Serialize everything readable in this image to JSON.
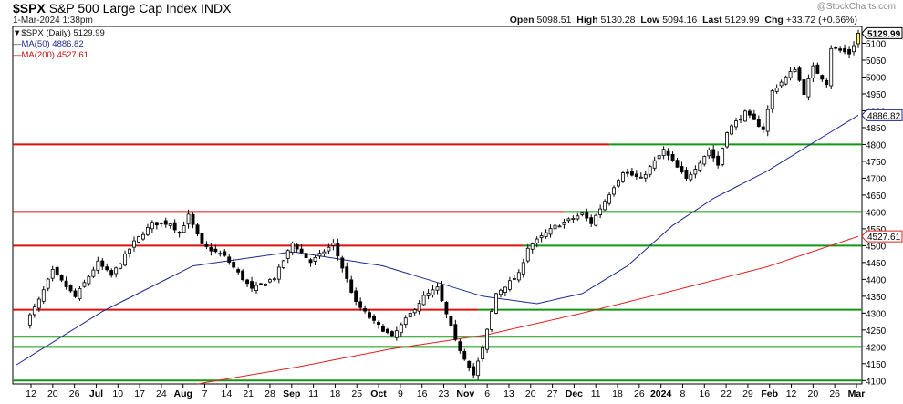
{
  "header": {
    "symbol": "$SPX",
    "name": "S&P 500 Large Cap Index",
    "exchange": "INDX",
    "datetime": "1-Mar-2024 1:38pm",
    "credit": "@StockCharts.com",
    "ohlc": {
      "open_label": "Open",
      "open": "5098.51",
      "high_label": "High",
      "high": "5130.28",
      "low_label": "Low",
      "low": "5094.16",
      "last_label": "Last",
      "last": "5129.99",
      "chg_label": "Chg",
      "chg": "+33.72 (+0.66%)"
    }
  },
  "legend": {
    "price": "$SPX (Daily) 5129.99",
    "ma50": "MA(50) 4886.82",
    "ma200": "MA(200) 4527.61"
  },
  "colors": {
    "red_line": "#dd1111",
    "green_line": "#139713",
    "ma50": "#1f2a8c",
    "ma200": "#e02020",
    "up_candle": "#ffffff",
    "down_candle": "#000000",
    "last_candle": "#ffff66"
  },
  "chart_data": {
    "type": "candlestick",
    "title": "$SPX S&P 500 Large Cap Index INDX",
    "y_axis": {
      "position": "right",
      "range": [
        4090,
        5150
      ],
      "ticks": [
        4100,
        4150,
        4200,
        4250,
        4300,
        4350,
        4400,
        4450,
        4500,
        4550,
        4600,
        4650,
        4700,
        4750,
        4800,
        4850,
        4900,
        4950,
        5000,
        5050,
        5100
      ],
      "tick_labels": [
        "4100",
        "4150",
        "4200",
        "4250",
        "4300",
        "4350",
        "4400",
        "4450",
        "4500",
        "4550",
        "4600",
        "4650",
        "4700",
        "4750",
        "4800",
        "4850",
        "4900",
        "4950",
        "5000",
        "5050",
        "5100"
      ]
    },
    "x_axis": {
      "labels": [
        "12",
        "20",
        "26",
        "Jul",
        "10",
        "17",
        "24",
        "Aug",
        "7",
        "14",
        "21",
        "28",
        "Sep",
        "11",
        "18",
        "25",
        "Oct",
        "9",
        "16",
        "23",
        "Nov",
        "6",
        "13",
        "20",
        "27",
        "Dec",
        "11",
        "18",
        "26",
        "2024",
        "8",
        "16",
        "22",
        "29",
        "Feb",
        "12",
        "20",
        "26",
        "Mar"
      ],
      "bold": [
        "Jul",
        "Aug",
        "Sep",
        "Oct",
        "Nov",
        "Dec",
        "2024",
        "Feb",
        "Mar"
      ]
    },
    "value_tags": [
      {
        "label": "5129.99",
        "value": 5129.99,
        "style": "last"
      },
      {
        "label": "4886.82",
        "value": 4886.82,
        "style": "ma50"
      },
      {
        "label": "4527.61",
        "value": 4527.61,
        "style": "ma200"
      }
    ],
    "horizontal_lines": [
      {
        "value": 4800,
        "left": "red",
        "right": "green",
        "split_date": "2023-12-11"
      },
      {
        "value": 4600,
        "left": "red",
        "right": "green",
        "split_date": "2023-11-27"
      },
      {
        "value": 4500,
        "left": "red",
        "right": "green",
        "split_date": "2023-11-13"
      },
      {
        "value": 4310,
        "left": "red",
        "right": "green",
        "split_date": "2023-10-30"
      },
      {
        "value": 4230,
        "left": "green",
        "right": "green",
        "split_date": "2023-10-30"
      },
      {
        "value": 4200,
        "left": "green",
        "right": "green",
        "split_date": "2023-10-30"
      },
      {
        "value": 4100,
        "left": "green",
        "right": "green",
        "split_date": "2023-10-30"
      }
    ],
    "series": [
      {
        "name": "$SPX (Daily)",
        "type": "candlestick",
        "anchors": [
          {
            "date": "2023-06-07",
            "close": 4270
          },
          {
            "date": "2023-06-12",
            "close": 4338
          },
          {
            "date": "2023-06-15",
            "close": 4425
          },
          {
            "date": "2023-06-23",
            "close": 4348
          },
          {
            "date": "2023-06-30",
            "close": 4450
          },
          {
            "date": "2023-07-06",
            "close": 4411
          },
          {
            "date": "2023-07-13",
            "close": 4510
          },
          {
            "date": "2023-07-19",
            "close": 4565
          },
          {
            "date": "2023-07-25",
            "close": 4567
          },
          {
            "date": "2023-07-27",
            "close": 4537
          },
          {
            "date": "2023-07-31",
            "close": 4589
          },
          {
            "date": "2023-08-03",
            "close": 4501
          },
          {
            "date": "2023-08-10",
            "close": 4468
          },
          {
            "date": "2023-08-18",
            "close": 4370
          },
          {
            "date": "2023-08-25",
            "close": 4405
          },
          {
            "date": "2023-08-31",
            "close": 4508
          },
          {
            "date": "2023-09-07",
            "close": 4451
          },
          {
            "date": "2023-09-14",
            "close": 4505
          },
          {
            "date": "2023-09-21",
            "close": 4330
          },
          {
            "date": "2023-09-27",
            "close": 4274
          },
          {
            "date": "2023-10-03",
            "close": 4229
          },
          {
            "date": "2023-10-12",
            "close": 4349
          },
          {
            "date": "2023-10-17",
            "close": 4374
          },
          {
            "date": "2023-10-23",
            "close": 4217
          },
          {
            "date": "2023-10-27",
            "close": 4117
          },
          {
            "date": "2023-10-31",
            "close": 4194
          },
          {
            "date": "2023-11-03",
            "close": 4358
          },
          {
            "date": "2023-11-10",
            "close": 4415
          },
          {
            "date": "2023-11-14",
            "close": 4495
          },
          {
            "date": "2023-11-22",
            "close": 4557
          },
          {
            "date": "2023-12-01",
            "close": 4594
          },
          {
            "date": "2023-12-05",
            "close": 4567
          },
          {
            "date": "2023-12-14",
            "close": 4720
          },
          {
            "date": "2023-12-20",
            "close": 4698
          },
          {
            "date": "2023-12-28",
            "close": 4783
          },
          {
            "date": "2024-01-05",
            "close": 4697
          },
          {
            "date": "2024-01-12",
            "close": 4784
          },
          {
            "date": "2024-01-17",
            "close": 4739
          },
          {
            "date": "2024-01-19",
            "close": 4840
          },
          {
            "date": "2024-01-25",
            "close": 4894
          },
          {
            "date": "2024-01-31",
            "close": 4846
          },
          {
            "date": "2024-02-02",
            "close": 4958
          },
          {
            "date": "2024-02-09",
            "close": 5026
          },
          {
            "date": "2024-02-13",
            "close": 4953
          },
          {
            "date": "2024-02-15",
            "close": 5029
          },
          {
            "date": "2024-02-21",
            "close": 4982
          },
          {
            "date": "2024-02-22",
            "close": 5087
          },
          {
            "date": "2024-02-28",
            "close": 5070
          },
          {
            "date": "2024-02-29",
            "close": 5096
          },
          {
            "date": "2024-03-01",
            "close": 5129.99
          }
        ]
      },
      {
        "name": "MA(50)",
        "type": "line",
        "points": [
          {
            "date": "2023-06-01",
            "value": 4130
          },
          {
            "date": "2023-07-03",
            "value": 4305
          },
          {
            "date": "2023-08-01",
            "value": 4440
          },
          {
            "date": "2023-08-31",
            "value": 4482
          },
          {
            "date": "2023-09-29",
            "value": 4440
          },
          {
            "date": "2023-10-31",
            "value": 4350
          },
          {
            "date": "2023-11-16",
            "value": 4328
          },
          {
            "date": "2023-12-01",
            "value": 4358
          },
          {
            "date": "2023-12-15",
            "value": 4440
          },
          {
            "date": "2024-01-02",
            "value": 4560
          },
          {
            "date": "2024-01-16",
            "value": 4640
          },
          {
            "date": "2024-02-01",
            "value": 4722
          },
          {
            "date": "2024-02-15",
            "value": 4805
          },
          {
            "date": "2024-03-01",
            "value": 4886.82
          }
        ]
      },
      {
        "name": "MA(200)",
        "type": "line",
        "points": [
          {
            "date": "2023-08-02",
            "value": 4090
          },
          {
            "date": "2023-09-01",
            "value": 4140
          },
          {
            "date": "2023-10-02",
            "value": 4192
          },
          {
            "date": "2023-11-01",
            "value": 4236
          },
          {
            "date": "2023-12-01",
            "value": 4300
          },
          {
            "date": "2024-01-02",
            "value": 4366
          },
          {
            "date": "2024-02-01",
            "value": 4438
          },
          {
            "date": "2024-03-01",
            "value": 4527.61
          }
        ]
      }
    ]
  }
}
